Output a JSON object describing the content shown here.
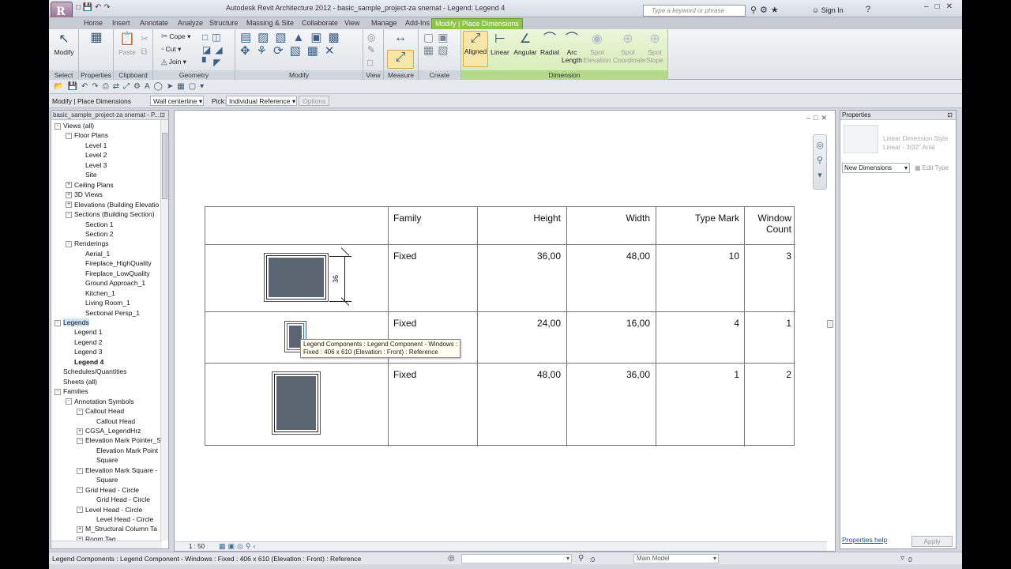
{
  "titlebar": {
    "app_logo": "R",
    "title": "Autodesk Revit Architecture 2012 -    basic_sample_project-za snemat - Legend: Legend 4",
    "search_placeholder": "Type a keyword or phrase",
    "sign_in": "Sign In",
    "help_icon": "?"
  },
  "tabs": [
    "Home",
    "Insert",
    "Annotate",
    "Analyze",
    "Structure",
    "Massing & Site",
    "Collaborate",
    "View",
    "Manage",
    "Add-Ins",
    "Modify | Place Dimensions"
  ],
  "ribbon": {
    "select": {
      "modify": "Modify",
      "label": "Select"
    },
    "properties": {
      "label": "Properties",
      "btn": "Properties"
    },
    "clipboard": {
      "label": "Clipboard",
      "paste": "Paste"
    },
    "geometry": {
      "label": "Geometry",
      "cope": "Cope",
      "cut": "Cut",
      "join": "Join"
    },
    "modify": {
      "label": "Modify"
    },
    "view": {
      "label": "View"
    },
    "measure": {
      "label": "Measure"
    },
    "create": {
      "label": "Create"
    },
    "dimension": {
      "label": "Dimension",
      "aligned": "Aligned",
      "linear": "Linear",
      "angular": "Angular",
      "radial": "Radial",
      "arc_length_1": "Arc",
      "arc_length_2": "Length",
      "spot_elev_1": "Spot",
      "spot_elev_2": "Elevation",
      "spot_coord_1": "Spot",
      "spot_coord_2": "Coordinate",
      "spot_slope_1": "Spot",
      "spot_slope_2": "Slope"
    }
  },
  "options_bar": {
    "context": "Modify | Place Dimensions",
    "placement": "Wall centerline",
    "pick_label": "Pick:",
    "pick_value": "Individual Reference",
    "options_btn": "Options"
  },
  "browser": {
    "title": "basic_sample_project-za snemat - P...",
    "items": [
      {
        "text": "Views (all)",
        "indent": 0,
        "exp": "-"
      },
      {
        "text": "Floor Plans",
        "indent": 1,
        "exp": "-"
      },
      {
        "text": "Level 1",
        "indent": 2
      },
      {
        "text": "Level 2",
        "indent": 2
      },
      {
        "text": "Level 3",
        "indent": 2
      },
      {
        "text": "Site",
        "indent": 2
      },
      {
        "text": "Ceiling Plans",
        "indent": 1,
        "exp": "+"
      },
      {
        "text": "3D Views",
        "indent": 1,
        "exp": "+"
      },
      {
        "text": "Elevations (Building Elevatio",
        "indent": 1,
        "exp": "+"
      },
      {
        "text": "Sections (Building Section)",
        "indent": 1,
        "exp": "-"
      },
      {
        "text": "Section 1",
        "indent": 2
      },
      {
        "text": "Section 2",
        "indent": 2
      },
      {
        "text": "Renderings",
        "indent": 1,
        "exp": "-"
      },
      {
        "text": "Aerial_1",
        "indent": 2
      },
      {
        "text": "Fireplace_HighQuality",
        "indent": 2
      },
      {
        "text": "Fireplace_LowQuality",
        "indent": 2
      },
      {
        "text": "Ground Approach_1",
        "indent": 2
      },
      {
        "text": "Kitchen_1",
        "indent": 2
      },
      {
        "text": "Living Room_1",
        "indent": 2
      },
      {
        "text": "Sectional Persp_1",
        "indent": 2
      },
      {
        "text": "Legends",
        "indent": 0,
        "exp": "-",
        "sel": true
      },
      {
        "text": "Legend 1",
        "indent": 1
      },
      {
        "text": "Legend 2",
        "indent": 1
      },
      {
        "text": "Legend 3",
        "indent": 1
      },
      {
        "text": "Legend 4",
        "indent": 1,
        "bold": true
      },
      {
        "text": "Schedules/Quantities",
        "indent": 0
      },
      {
        "text": "Sheets (all)",
        "indent": 0
      },
      {
        "text": "Families",
        "indent": 0,
        "exp": "-"
      },
      {
        "text": "Annotation Symbols",
        "indent": 1,
        "exp": "-"
      },
      {
        "text": "Callout Head",
        "indent": 2,
        "exp": "-"
      },
      {
        "text": "Callout Head",
        "indent": 3
      },
      {
        "text": "CGSA_LegendHrz",
        "indent": 2,
        "exp": "+"
      },
      {
        "text": "Elevation Mark Pointer_S",
        "indent": 2,
        "exp": "-"
      },
      {
        "text": "Elevation Mark Point",
        "indent": 3
      },
      {
        "text": "Square",
        "indent": 3
      },
      {
        "text": "Elevation Mark Square -",
        "indent": 2,
        "exp": "-"
      },
      {
        "text": "Square",
        "indent": 3
      },
      {
        "text": "Grid Head - Circle",
        "indent": 2,
        "exp": "-"
      },
      {
        "text": "Grid Head - Circle",
        "indent": 3
      },
      {
        "text": "Level Head - Circle",
        "indent": 2,
        "exp": "-"
      },
      {
        "text": "Level Head - Circle",
        "indent": 3
      },
      {
        "text": "M_Structural Column Ta",
        "indent": 2,
        "exp": "+"
      },
      {
        "text": "Room Tag",
        "indent": 2,
        "exp": "+"
      }
    ]
  },
  "legend": {
    "headers": [
      "Family",
      "Height",
      "Width",
      "Type Mark",
      "Window",
      "Count"
    ],
    "rows": [
      {
        "family": "Fixed",
        "height": "36,00",
        "width": "48,00",
        "type_mark": "10",
        "count": "3"
      },
      {
        "family": "Fixed",
        "height": "24,00",
        "width": "16,00",
        "type_mark": "4",
        "count": "1"
      },
      {
        "family": "Fixed",
        "height": "48,00",
        "width": "36,00",
        "type_mark": "1",
        "count": "2"
      }
    ],
    "dimension_text": "36",
    "tooltip_line1": "Legend Components : Legend Component - Windows :",
    "tooltip_line2": "Fixed : 406 x 610 (Elevation : Front) : Reference"
  },
  "view_status": {
    "scale": "1 : 50"
  },
  "properties": {
    "title": "Properties",
    "type_name_1": "Linear Dimension Style",
    "type_name_2": "Linear - 3/32\" Arial",
    "selector": "New Dimensions",
    "edit_type": "Edit Type",
    "help_link": "Properties help",
    "apply": "Apply"
  },
  "status": {
    "message": "Legend Components : Legend Component - Windows : Fixed : 406 x 610 (Elevation : Front) : Reference",
    "zero_a": ":0",
    "model": "Main Model",
    "zero_b": "0"
  }
}
